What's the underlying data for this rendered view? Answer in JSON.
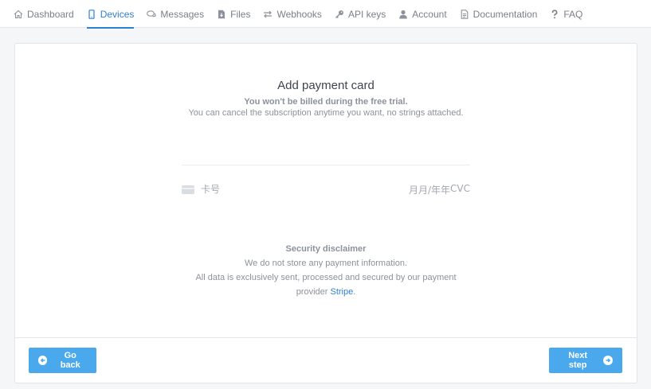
{
  "nav": {
    "items": [
      {
        "label": "Dashboard",
        "icon": "home-icon",
        "active": false
      },
      {
        "label": "Devices",
        "icon": "phone-icon",
        "active": true
      },
      {
        "label": "Messages",
        "icon": "chat-icon",
        "active": false
      },
      {
        "label": "Files",
        "icon": "file-download-icon",
        "active": false
      },
      {
        "label": "Webhooks",
        "icon": "exchange-icon",
        "active": false
      },
      {
        "label": "API keys",
        "icon": "key-icon",
        "active": false
      },
      {
        "label": "Account",
        "icon": "user-icon",
        "active": false
      },
      {
        "label": "Documentation",
        "icon": "document-icon",
        "active": false
      },
      {
        "label": "FAQ",
        "icon": "question-icon",
        "active": false
      }
    ]
  },
  "payment": {
    "title": "Add payment card",
    "subtitle_bold": "You won't be billed during the free trial.",
    "subtitle": "You can cancel the subscription anytime you want, no strings attached.",
    "card_number_placeholder": "卡号",
    "expiry_placeholder": "月月/年年",
    "cvc_placeholder": "CVC"
  },
  "disclaimer": {
    "title": "Security disclaimer",
    "line1": "We do not store any payment information.",
    "line2": "All data is exclusively sent, processed and secured by our payment",
    "line3_prefix": "provider ",
    "line3_link": "Stripe",
    "line3_suffix": "."
  },
  "footer": {
    "back_label": "Go back",
    "next_label": "Next step"
  },
  "colors": {
    "accent": "#2f7fd1",
    "button": "#4aa8ec"
  }
}
